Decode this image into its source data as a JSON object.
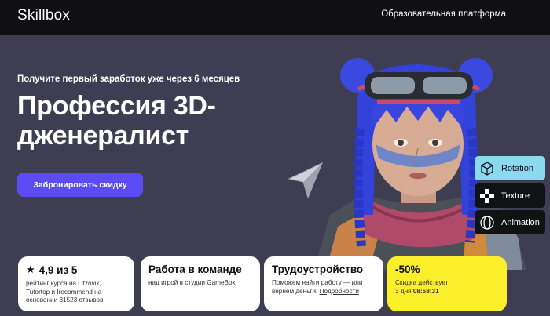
{
  "header": {
    "logo": "Skillbox",
    "nav_link": "Образовательная платформа"
  },
  "hero": {
    "subtitle": "Получите первый заработок уже через 6 месяцев",
    "title": "Профессия 3D-дженералист",
    "cta_label": "Забронировать скидку"
  },
  "tools": [
    {
      "label": "Rotation",
      "icon": "cube-icon"
    },
    {
      "label": "Texture",
      "icon": "checker-icon"
    },
    {
      "label": "Animation",
      "icon": "rings-icon"
    }
  ],
  "cards": {
    "rating": {
      "title": "4,9 из 5",
      "text": "рейтинг курса на Otzovik, Tutortop и Irecommend на основании 31523 отзывов"
    },
    "team": {
      "title": "Работа в команде",
      "text": "над игрой в студии GameBox"
    },
    "job": {
      "title": "Трудоустройство",
      "text": "Поможем найти работу — или вернём деньги.",
      "link": "Подробности"
    },
    "discount": {
      "title": "-50%",
      "label": "Скидка действует",
      "timer_prefix": "3 дня",
      "timer": "08:58:31"
    }
  },
  "colors": {
    "hero_bg": "#3e3d52",
    "accent": "#5a4cf2",
    "discount_bg": "#fbee2a",
    "rotation_bg": "#8bd9ee"
  }
}
